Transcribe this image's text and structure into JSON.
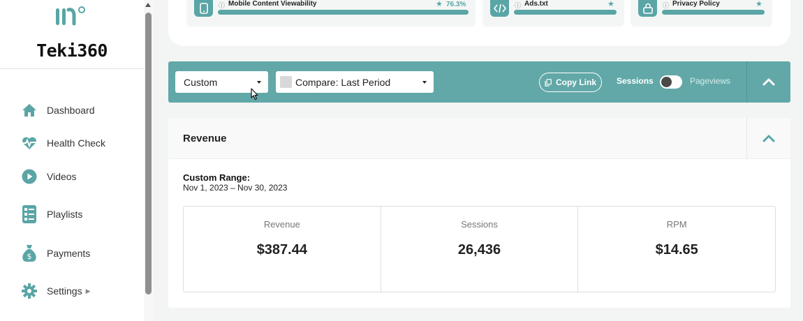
{
  "app": {
    "name": "Teki360"
  },
  "colors": {
    "accent": "#5aa5a6",
    "filter_bar": "#62a8a8"
  },
  "sidebar": {
    "items": [
      {
        "label": "Dashboard",
        "icon": "home-icon"
      },
      {
        "label": "Health Check",
        "icon": "heartbeat-icon"
      },
      {
        "label": "Videos",
        "icon": "play-circle-icon"
      },
      {
        "label": "Playlists",
        "icon": "list-icon"
      },
      {
        "label": "Payments",
        "icon": "money-bag-icon"
      },
      {
        "label": "Settings",
        "icon": "gear-icon"
      }
    ]
  },
  "health_tiles": [
    {
      "name": "Mobile Content Viewability",
      "score": "76.3%",
      "icon": "mobile-icon"
    },
    {
      "name": "Ads.txt",
      "icon": "code-icon"
    },
    {
      "name": "Privacy Policy",
      "icon": "lock-icon"
    }
  ],
  "filters": {
    "range_select": "Custom",
    "compare_select": "Compare: Last Period",
    "copy_link": "Copy Link",
    "toggle_left": "Sessions",
    "toggle_right": "Pageviews"
  },
  "revenue": {
    "title": "Revenue",
    "range_label": "Custom Range:",
    "range_dates": "Nov 1, 2023 – Nov 30, 2023",
    "stats": [
      {
        "label": "Revenue",
        "value": "$387.44"
      },
      {
        "label": "Sessions",
        "value": "26,436"
      },
      {
        "label": "RPM",
        "value": "$14.65"
      }
    ]
  }
}
